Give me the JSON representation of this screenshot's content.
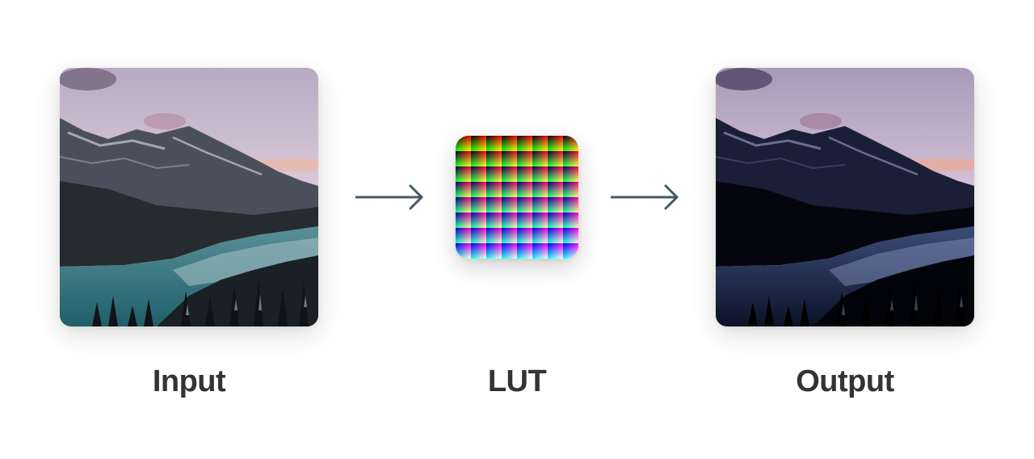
{
  "labels": {
    "input": "Input",
    "lut": "LUT",
    "output": "Output"
  },
  "colors": {
    "label_text": "#333333",
    "arrow": "#455a64",
    "background": "#ffffff"
  },
  "icons": {
    "arrow": "arrow-right-icon"
  },
  "lut": {
    "grid_size": 8
  }
}
